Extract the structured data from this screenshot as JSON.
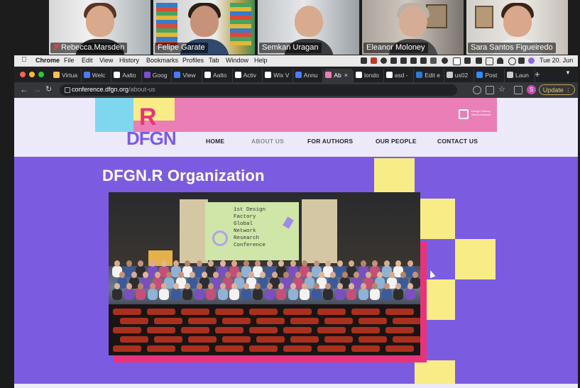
{
  "participants": [
    {
      "name": "Rebecca.Marsden",
      "muted": true
    },
    {
      "name": "Felipe Garate",
      "muted": false
    },
    {
      "name": "Semkan Uragan",
      "muted": false
    },
    {
      "name": "Eleanor Moloney",
      "muted": false
    },
    {
      "name": "Sara Santos Figueiredo",
      "muted": false
    }
  ],
  "menubar": {
    "items": [
      "Chrome",
      "File",
      "Edit",
      "View",
      "History",
      "Bookmarks",
      "Profiles",
      "Tab",
      "Window",
      "Help"
    ],
    "clock": "Tue 20. Jun"
  },
  "tabs": [
    {
      "label": "Virtua",
      "icon": "virtual-icon",
      "color": "#f2c14e"
    },
    {
      "label": "Welc",
      "icon": "doc-icon",
      "color": "#4a7cf6"
    },
    {
      "label": "Aalto",
      "icon": "aalto-icon",
      "color": "#ffffff"
    },
    {
      "label": "Goog",
      "icon": "forms-icon",
      "color": "#7b4fd6"
    },
    {
      "label": "View",
      "icon": "view-icon",
      "color": "#4a7cf6"
    },
    {
      "label": "Aalto",
      "icon": "aalto-v-icon",
      "color": "#ffffff"
    },
    {
      "label": "Activ",
      "icon": "wix-icon",
      "color": "#ffffff"
    },
    {
      "label": "Wix V",
      "icon": "wix-icon",
      "color": "#ffffff"
    },
    {
      "label": "Annu",
      "icon": "doc-icon",
      "color": "#4a7cf6"
    },
    {
      "label": "Ab",
      "icon": "dfgn-icon",
      "color": "#e97fb6"
    },
    {
      "label": "londo",
      "icon": "google-icon",
      "color": "#ffffff"
    },
    {
      "label": "asd -",
      "icon": "google-icon",
      "color": "#ffffff"
    },
    {
      "label": "Edit e",
      "icon": "wordpress-icon",
      "color": "#2a7bd6"
    },
    {
      "label": "us02",
      "icon": "zoom-icon",
      "color": "#cccccc"
    },
    {
      "label": "Post",
      "icon": "zoom-icon",
      "color": "#2d8cff"
    },
    {
      "label": "Laun",
      "icon": "globe-icon",
      "color": "#cccccc"
    }
  ],
  "toolbar": {
    "url_host": "conference.dfgn.org",
    "url_path": "/about-us",
    "profile_initial": "S",
    "update_label": "Update"
  },
  "site": {
    "logo_letters": "DFGN",
    "logo_r": "R",
    "brand_mark_text": "Design Factory Global Network",
    "nav": [
      "HOME",
      "ABOUT US",
      "FOR AUTHORS",
      "OUR PEOPLE",
      "CONTACT US"
    ],
    "active_nav": "ABOUT US",
    "page_title": "DFGN.R Organization",
    "photo_screen_text": [
      "1st Design",
      "Factory",
      "Global",
      "Network",
      "Research",
      "Conference"
    ]
  },
  "colors": {
    "hero_bg": "#7b5ce0",
    "pink": "#e97fb6",
    "yellow": "#f8ec86",
    "magenta": "#e8337a"
  }
}
